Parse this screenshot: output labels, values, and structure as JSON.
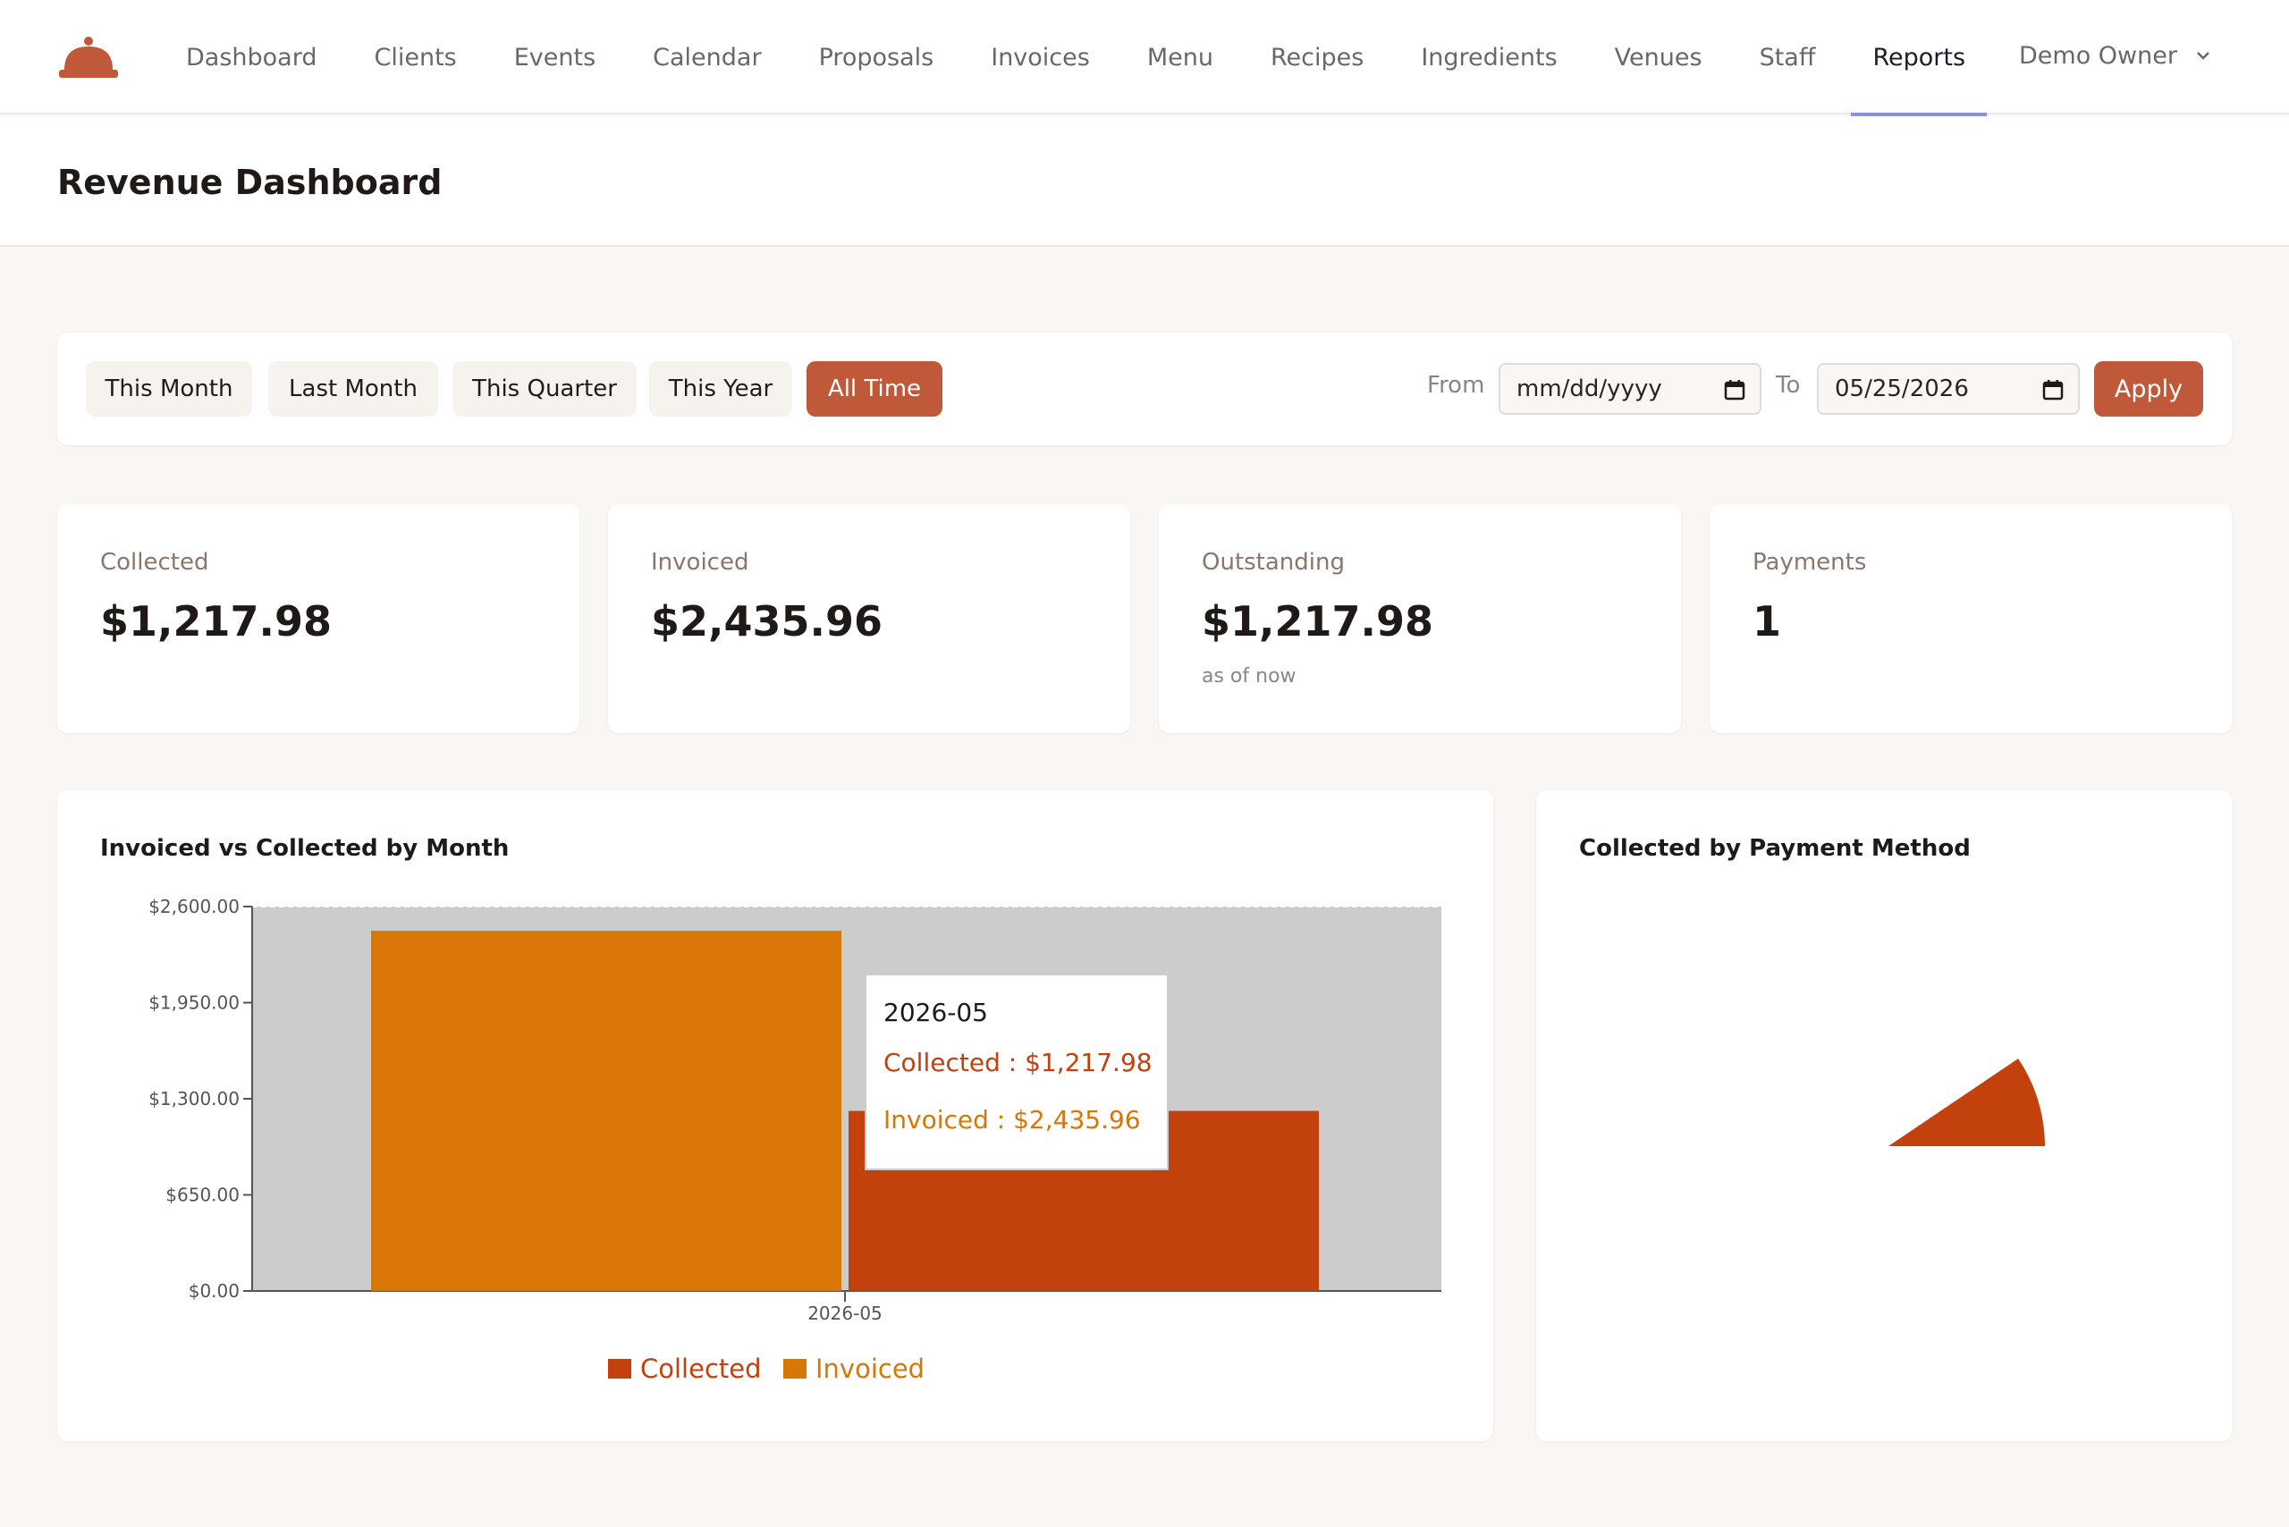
{
  "nav": {
    "items": [
      {
        "label": "Dashboard"
      },
      {
        "label": "Clients"
      },
      {
        "label": "Events"
      },
      {
        "label": "Calendar"
      },
      {
        "label": "Proposals"
      },
      {
        "label": "Invoices"
      },
      {
        "label": "Menu"
      },
      {
        "label": "Recipes"
      },
      {
        "label": "Ingredients"
      },
      {
        "label": "Venues"
      },
      {
        "label": "Staff"
      },
      {
        "label": "Reports"
      }
    ],
    "active": "Reports",
    "user": "Demo Owner",
    "logo_icon": "cloche-icon",
    "brand_color": "#c0583a"
  },
  "page": {
    "title": "Revenue Dashboard"
  },
  "range": {
    "buttons": [
      {
        "label": "This Month"
      },
      {
        "label": "Last Month"
      },
      {
        "label": "This Quarter"
      },
      {
        "label": "This Year"
      },
      {
        "label": "All Time"
      }
    ],
    "active": "All Time",
    "from_label": "From",
    "from_value": "mm/dd/yyyy",
    "to_label": "To",
    "to_value": "05/25/2026",
    "apply_label": "Apply"
  },
  "stats": [
    {
      "label": "Collected",
      "value": "$1,217.98"
    },
    {
      "label": "Invoiced",
      "value": "$2,435.96"
    },
    {
      "label": "Outstanding",
      "value": "$1,217.98",
      "note": "as of now"
    },
    {
      "label": "Payments",
      "value": "1"
    }
  ],
  "charts": {
    "monthly_title": "Invoiced vs Collected by Month",
    "method_title": "Collected by Payment Method",
    "tooltip": {
      "title": "2026-05",
      "collected": "Collected : $1,217.98",
      "invoiced": "Invoiced : $2,435.96"
    }
  },
  "chart_data": [
    {
      "type": "bar",
      "title": "Invoiced vs Collected by Month",
      "categories": [
        "2026-05"
      ],
      "series": [
        {
          "name": "Invoiced",
          "values": [
            2435.96
          ],
          "color": "#d97706"
        },
        {
          "name": "Collected",
          "values": [
            1217.98
          ],
          "color": "#c2410c"
        }
      ],
      "legend": [
        "Collected",
        "Invoiced"
      ],
      "y_ticks": [
        "$0.00",
        "$650.00",
        "$1,300.00",
        "$1,950.00",
        "$2,600.00"
      ],
      "ylim": [
        0,
        2600
      ],
      "grid": true,
      "legend_position": "bottom"
    },
    {
      "type": "pie",
      "title": "Collected by Payment Method",
      "slices": [
        {
          "value": 1217.98,
          "color": "#c2410c"
        }
      ]
    }
  ]
}
